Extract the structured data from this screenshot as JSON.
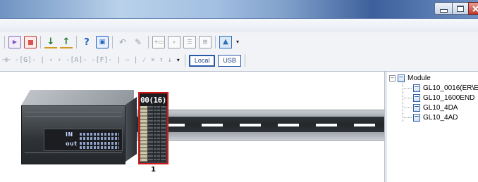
{
  "window": {
    "controls": {
      "minimize_icon": "minimize-icon",
      "maximize_icon": "maximize-icon",
      "close_icon": "close-icon"
    }
  },
  "toolbar": {
    "row1_icons": [
      "run-icon",
      "stop-icon",
      "download-icon",
      "upload-icon",
      "online-help-icon",
      "monitor-icon",
      "undo-icon",
      "edit-icon",
      "insert-icon",
      "find-icon",
      "table-icon",
      "grid-icon",
      "chart-icon"
    ],
    "row2": {
      "ladder_symbols": "⊣⊢ -[G]- | ‹ › -[A]- -[F]- | — | ⁄ ⨯ ↑ ↓",
      "local_label": "Local",
      "usb_label": "USB"
    }
  },
  "canvas": {
    "cpu": {
      "in_label": "IN",
      "out_label": "out"
    },
    "module": {
      "display": "00(16)",
      "slot_number": "1"
    }
  },
  "module_tree": {
    "root_label": "Module",
    "expander": "−",
    "items": [
      {
        "label": "GL10_0016(ER\\E"
      },
      {
        "label": "GL10_1600END"
      },
      {
        "label": "GL10_4DA"
      },
      {
        "label": "GL10_4AD"
      }
    ]
  }
}
